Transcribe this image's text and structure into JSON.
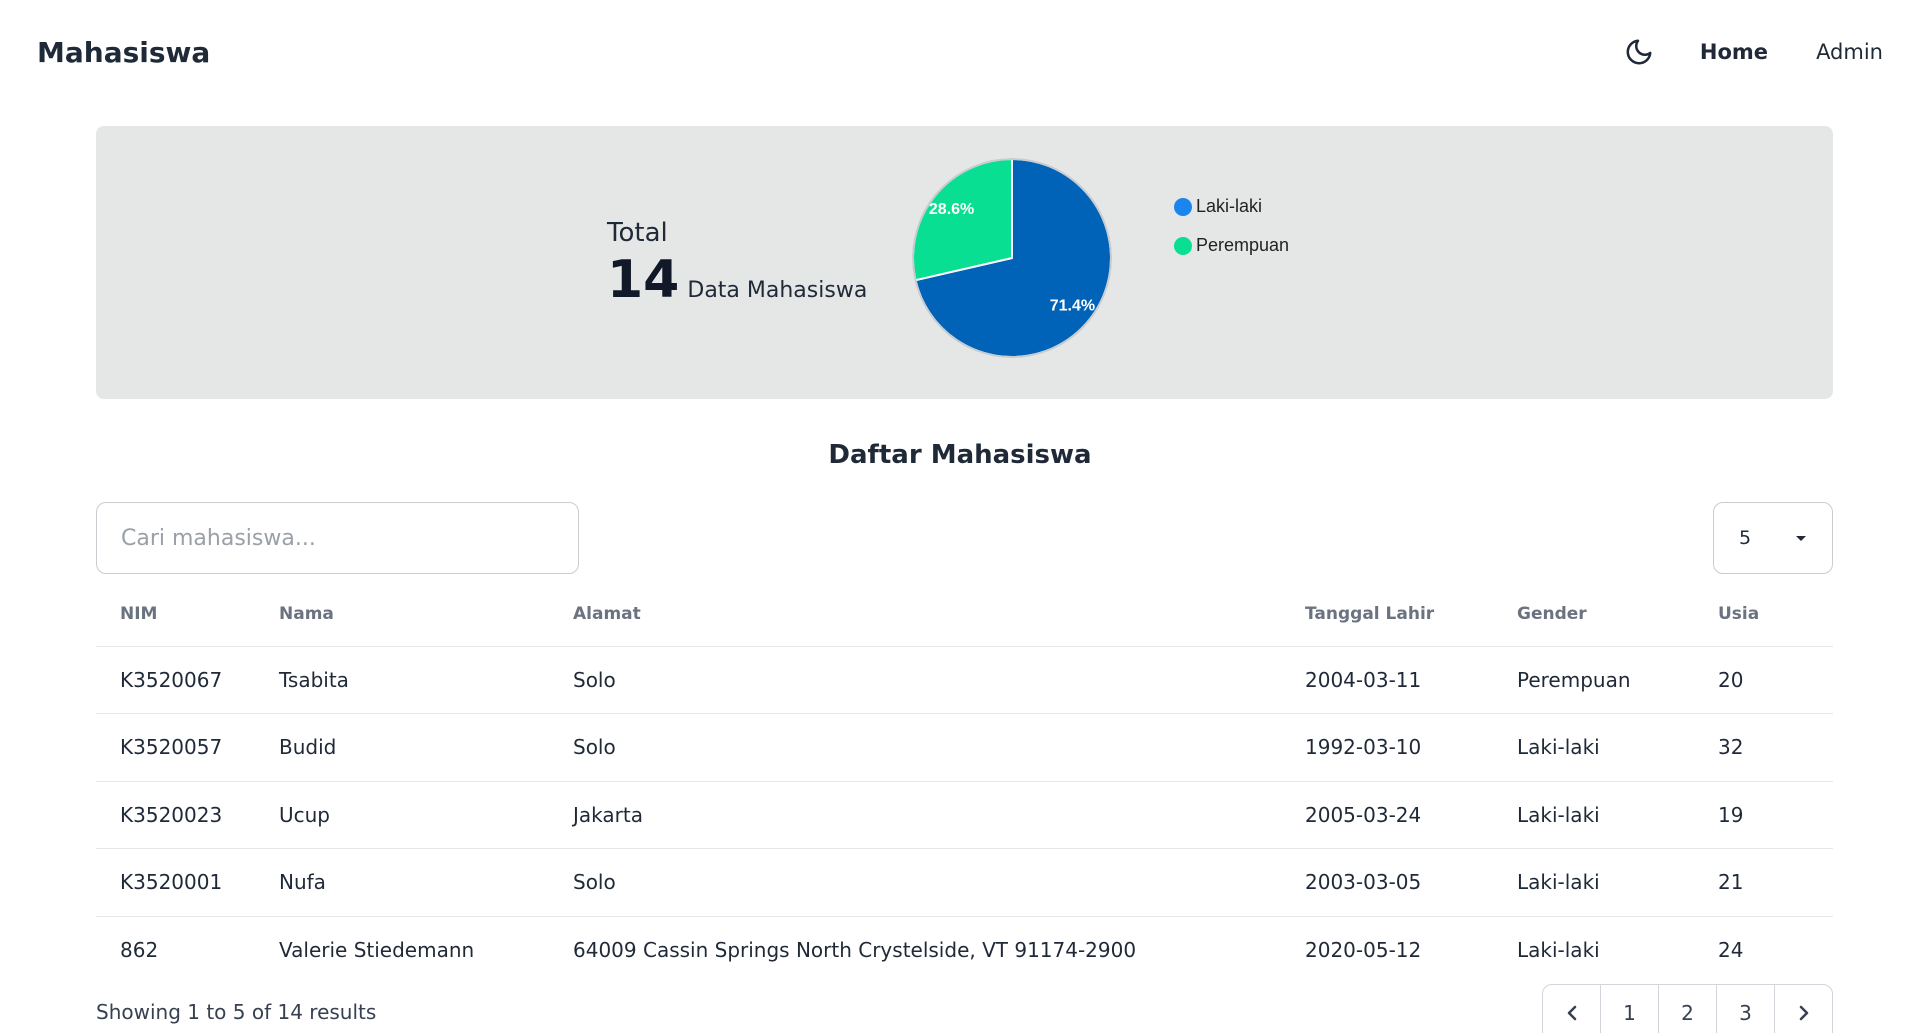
{
  "navbar": {
    "brand": "Mahasiswa",
    "home_label": "Home",
    "admin_label": "Admin",
    "theme_icon": "moon-icon"
  },
  "stats": {
    "total_label": "Total",
    "total_count": "14",
    "total_suffix": "Data Mahasiswa"
  },
  "chart_data": {
    "type": "pie",
    "categories": [
      "Laki-laki",
      "Perempuan"
    ],
    "values": [
      71.4,
      28.6
    ],
    "labels": [
      "71.4%",
      "28.6%"
    ],
    "colors": [
      "#0063b8",
      "#09df93"
    ],
    "legend_colors": [
      "#1a84ef",
      "#09df93"
    ],
    "legend_position": "right"
  },
  "section": {
    "title": "Daftar Mahasiswa"
  },
  "search": {
    "placeholder": "Cari mahasiswa..."
  },
  "per_page": {
    "value": "5"
  },
  "table": {
    "headers": [
      "NIM",
      "Nama",
      "Alamat",
      "Tanggal Lahir",
      "Gender",
      "Usia"
    ],
    "rows": [
      [
        "K3520067",
        "Tsabita",
        "Solo",
        "2004-03-11",
        "Perempuan",
        "20"
      ],
      [
        "K3520057",
        "Budid",
        "Solo",
        "1992-03-10",
        "Laki-laki",
        "32"
      ],
      [
        "K3520023",
        "Ucup",
        "Jakarta",
        "2005-03-24",
        "Laki-laki",
        "19"
      ],
      [
        "K3520001",
        "Nufa",
        "Solo",
        "2003-03-05",
        "Laki-laki",
        "21"
      ],
      [
        "862",
        "Valerie Stiedemann",
        "64009 Cassin Springs North Crystelside, VT 91174-2900",
        "2020-05-12",
        "Laki-laki",
        "24"
      ]
    ]
  },
  "footer": {
    "results_text": "Showing 1 to 5 of 14 results",
    "pages": [
      "1",
      "2",
      "3"
    ]
  },
  "colors": {
    "card_bg": "#e5e7e7",
    "border": "#d1d5db",
    "text": "#1f2937",
    "header_text": "#6b7280"
  }
}
